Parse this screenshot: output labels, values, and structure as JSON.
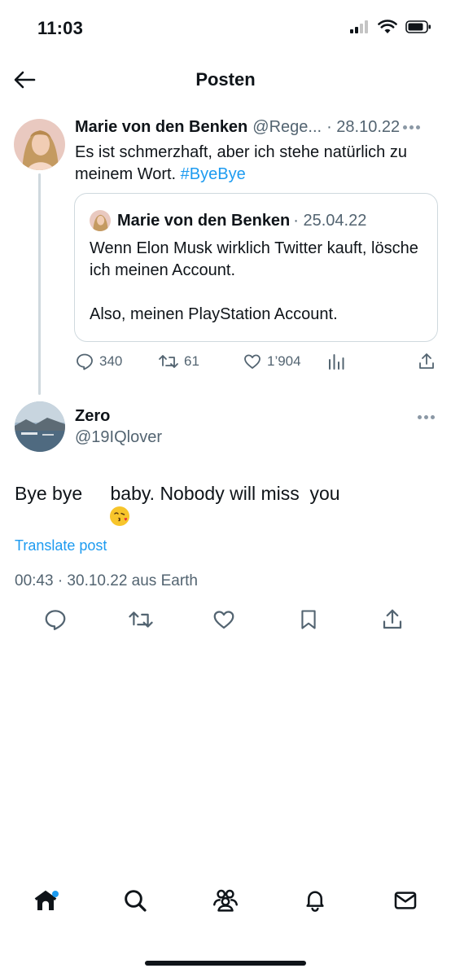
{
  "status_bar": {
    "time": "11:03"
  },
  "nav": {
    "title": "Posten"
  },
  "parent_post": {
    "author_name": "Marie von den Benken",
    "handle": "@Rege...",
    "date": "· 28.10.22",
    "text": "Es ist schmerzhaft, aber ich stehe natürlich zu meinem Wort.",
    "hashtag": "#ByeBye",
    "quote": {
      "author_name": "Marie von den Benken",
      "date": "· 25.04.22",
      "line1": "Wenn Elon Musk wirklich Twitter kauft, lösche ich meinen Account.",
      "line2": "Also, meinen PlayStation Account."
    },
    "stats": {
      "replies": "340",
      "reposts": "61",
      "likes": "1’904"
    }
  },
  "reply": {
    "author_name": "Zero",
    "handle": "@19IQlover",
    "text_before": "Bye bye ",
    "text_after": "baby. Nobody will miss  you",
    "emoji": "kissing-face-with-heart-emoji",
    "translate_label": "Translate post",
    "meta": "00:43 · 30.10.22 aus Earth"
  },
  "icons": {
    "accent": "#1d9bf0",
    "muted": "#536471",
    "text": "#0f1419"
  }
}
